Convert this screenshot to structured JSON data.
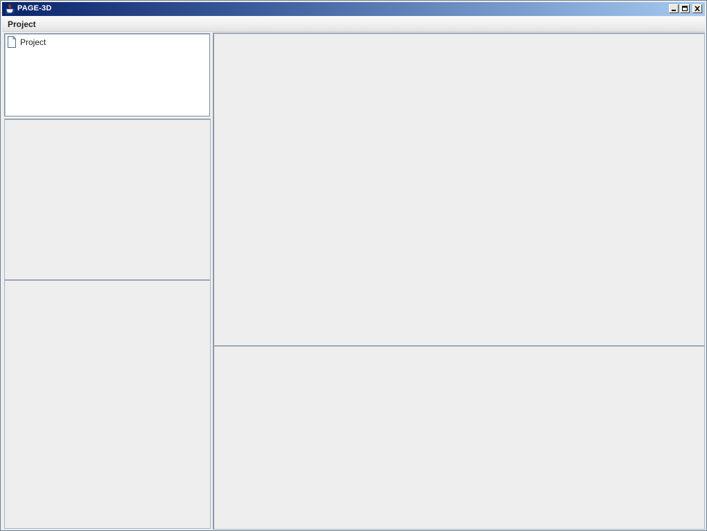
{
  "window": {
    "title": "PAGE-3D",
    "titlebar_colors": [
      "#0a246a",
      "#a6caf0"
    ]
  },
  "menubar": {
    "items": [
      {
        "label": "Project"
      }
    ]
  },
  "tree": {
    "items": [
      {
        "label": "Project",
        "icon": "document-icon"
      }
    ]
  },
  "colors": {
    "panel_bg": "#eeeeee",
    "tree_bg": "#ffffff",
    "border": "#7a8a99"
  }
}
